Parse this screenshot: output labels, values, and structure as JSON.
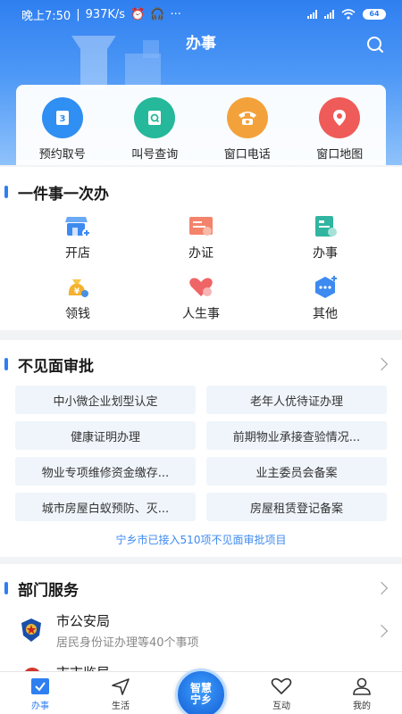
{
  "status": {
    "time": "晚上7:50",
    "speed": "937K/s",
    "battery": "64"
  },
  "header": {
    "title": "办事"
  },
  "quick": [
    {
      "label": "预约取号",
      "icon": "ticket-icon",
      "color": "#2f8ff2"
    },
    {
      "label": "叫号查询",
      "icon": "search-doc-icon",
      "color": "#25b89a"
    },
    {
      "label": "窗口电话",
      "icon": "phone-icon",
      "color": "#f3a23b"
    },
    {
      "label": "窗口地图",
      "icon": "map-pin-icon",
      "color": "#ef5b58"
    }
  ],
  "one_thing": {
    "title": "一件事一次办",
    "items": [
      {
        "label": "开店",
        "icon": "shop-icon"
      },
      {
        "label": "办证",
        "icon": "certificate-icon"
      },
      {
        "label": "办事",
        "icon": "document-icon"
      },
      {
        "label": "领钱",
        "icon": "money-bag-icon"
      },
      {
        "label": "人生事",
        "icon": "heart-icon"
      },
      {
        "label": "其他",
        "icon": "hexagon-more-icon"
      }
    ]
  },
  "approval": {
    "title": "不见面审批",
    "items": [
      "中小微企业划型认定",
      "老年人优待证办理",
      "健康证明办理",
      "前期物业承接查验情况...",
      "物业专项维修资金缴存...",
      "业主委员会备案",
      "城市房屋白蚁预防、灭...",
      "房屋租赁登记备案"
    ],
    "note": "宁乡市已接入510项不见面审批项目"
  },
  "department": {
    "title": "部门服务",
    "items": [
      {
        "name": "市公安局",
        "sub": "居民身份证办理等40个事项",
        "icon": "police-badge-icon"
      },
      {
        "name": "市市监局",
        "sub": "",
        "icon": "emblem-icon"
      }
    ]
  },
  "tabs": [
    {
      "label": "办事",
      "icon": "checkbox-icon",
      "active": true
    },
    {
      "label": "生活",
      "icon": "navigation-icon",
      "active": false
    },
    {
      "label": "互动",
      "icon": "heart-outline-icon",
      "active": false
    },
    {
      "label": "我的",
      "icon": "user-icon",
      "active": false
    }
  ],
  "center_button": {
    "line1": "智慧",
    "line2": "宁乡"
  }
}
